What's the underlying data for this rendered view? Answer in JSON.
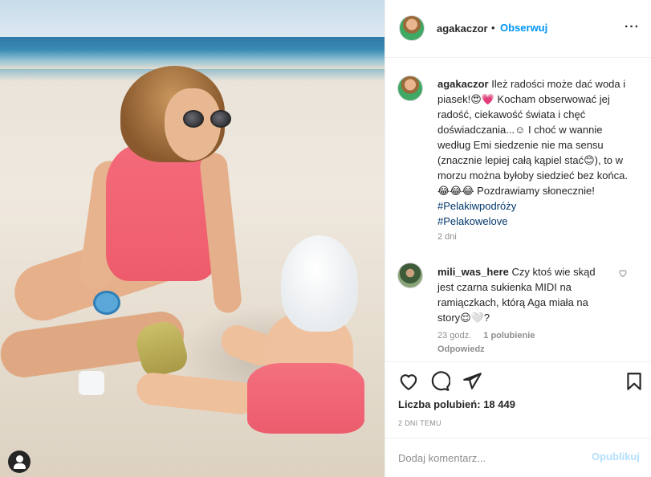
{
  "post": {
    "author": "agakaczor",
    "follow_label": "Obserwuj",
    "caption_text": "Ileż radości może dać woda i piasek!😍💗 Kocham obserwować jej radość, ciekawość świata i chęć doświadczania...☺ I choć w wannie według Emi siedzenie nie ma sensu (znacznie lepiej całą kąpiel stać😊), to w morzu można byłoby siedzieć bez końca.😂😂😂 Pozdrawiamy słonecznie!",
    "tags": [
      "#Pelakiwpodróży",
      "#Pelakowelove"
    ],
    "caption_age": "2 dni",
    "likes_label": "Liczba polubień:",
    "likes_count": "18 449",
    "posted_ago": "2 dni temu"
  },
  "comment": {
    "author": "mili_was_here",
    "text": "Czy ktoś wie skąd jest czarna sukienka MIDI na ramiączkach, którą Aga miała na story😌🤍?",
    "age": "23 godz.",
    "likes": "1 polubienie",
    "reply_label": "Odpowiedz"
  },
  "composer": {
    "placeholder": "Dodaj komentarz...",
    "publish_label": "Opublikuj"
  },
  "icons": {
    "more": "more-icon",
    "like": "heart-icon",
    "comment": "comment-icon",
    "share": "share-icon",
    "save": "bookmark-icon",
    "comment_like": "small-heart-icon",
    "account": "user-icon"
  },
  "colors": {
    "link_blue": "#0095f6",
    "tag_blue": "#00376b",
    "publish_disabled": "#b2dffc",
    "muted_text": "#8e8e8e"
  }
}
